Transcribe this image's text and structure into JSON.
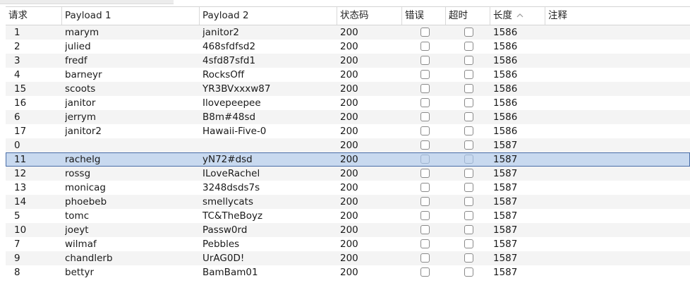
{
  "columns": {
    "request": "请求",
    "payload1": "Payload 1",
    "payload2": "Payload 2",
    "status": "状态码",
    "error": "错误",
    "timeout": "超时",
    "length": "长度",
    "comment": "注释"
  },
  "sort": {
    "column": "length",
    "direction": "ascending",
    "icon": "sort-ascending-icon"
  },
  "selected_request": "11",
  "rows": [
    {
      "request": "1",
      "payload1": "marym",
      "payload2": "janitor2",
      "status": "200",
      "error": false,
      "timeout": false,
      "length": "1586",
      "comment": ""
    },
    {
      "request": "2",
      "payload1": "julied",
      "payload2": "468sfdfsd2",
      "status": "200",
      "error": false,
      "timeout": false,
      "length": "1586",
      "comment": ""
    },
    {
      "request": "3",
      "payload1": "fredf",
      "payload2": "4sfd87sfd1",
      "status": "200",
      "error": false,
      "timeout": false,
      "length": "1586",
      "comment": ""
    },
    {
      "request": "4",
      "payload1": "barneyr",
      "payload2": "RocksOff",
      "status": "200",
      "error": false,
      "timeout": false,
      "length": "1586",
      "comment": ""
    },
    {
      "request": "15",
      "payload1": "scoots",
      "payload2": "YR3BVxxxw87",
      "status": "200",
      "error": false,
      "timeout": false,
      "length": "1586",
      "comment": ""
    },
    {
      "request": "16",
      "payload1": "janitor",
      "payload2": "Ilovepeepee",
      "status": "200",
      "error": false,
      "timeout": false,
      "length": "1586",
      "comment": ""
    },
    {
      "request": "6",
      "payload1": "jerrym",
      "payload2": "B8m#48sd",
      "status": "200",
      "error": false,
      "timeout": false,
      "length": "1586",
      "comment": ""
    },
    {
      "request": "17",
      "payload1": "janitor2",
      "payload2": "Hawaii-Five-0",
      "status": "200",
      "error": false,
      "timeout": false,
      "length": "1586",
      "comment": ""
    },
    {
      "request": "0",
      "payload1": "",
      "payload2": "",
      "status": "200",
      "error": false,
      "timeout": false,
      "length": "1587",
      "comment": ""
    },
    {
      "request": "11",
      "payload1": "rachelg",
      "payload2": "yN72#dsd",
      "status": "200",
      "error": false,
      "timeout": false,
      "length": "1587",
      "comment": ""
    },
    {
      "request": "12",
      "payload1": "rossg",
      "payload2": "ILoveRachel",
      "status": "200",
      "error": false,
      "timeout": false,
      "length": "1587",
      "comment": ""
    },
    {
      "request": "13",
      "payload1": "monicag",
      "payload2": "3248dsds7s",
      "status": "200",
      "error": false,
      "timeout": false,
      "length": "1587",
      "comment": ""
    },
    {
      "request": "14",
      "payload1": "phoebeb",
      "payload2": "smellycats",
      "status": "200",
      "error": false,
      "timeout": false,
      "length": "1587",
      "comment": ""
    },
    {
      "request": "5",
      "payload1": "tomc",
      "payload2": "TC&TheBoyz",
      "status": "200",
      "error": false,
      "timeout": false,
      "length": "1587",
      "comment": ""
    },
    {
      "request": "10",
      "payload1": "joeyt",
      "payload2": "Passw0rd",
      "status": "200",
      "error": false,
      "timeout": false,
      "length": "1587",
      "comment": ""
    },
    {
      "request": "7",
      "payload1": "wilmaf",
      "payload2": "Pebbles",
      "status": "200",
      "error": false,
      "timeout": false,
      "length": "1587",
      "comment": ""
    },
    {
      "request": "9",
      "payload1": "chandlerb",
      "payload2": "UrAG0D!",
      "status": "200",
      "error": false,
      "timeout": false,
      "length": "1587",
      "comment": ""
    },
    {
      "request": "8",
      "payload1": "bettyr",
      "payload2": "BamBam01",
      "status": "200",
      "error": false,
      "timeout": false,
      "length": "1587",
      "comment": ""
    }
  ],
  "colors": {
    "selected_row": "#c8d9ef",
    "selected_outline": "#4a6ea8",
    "alt_row": "#f4f4f4"
  }
}
